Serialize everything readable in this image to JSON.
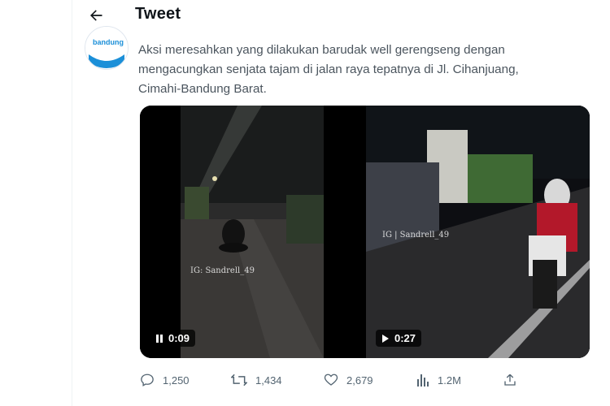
{
  "header": {
    "title": "Tweet"
  },
  "account": {
    "avatar_text": "bandung"
  },
  "tweet": {
    "text": "Aksi meresahkan yang dilakukan barudak well gerengseng dengan\nmengacungkan senjata tajam di jalan raya tepatnya di Jl. Cihanjuang,\nCimahi-Bandung Barat."
  },
  "media": [
    {
      "duration": "0:09",
      "state_icon": "pause-icon",
      "watermark": "IG: Sandrell_49"
    },
    {
      "duration": "0:27",
      "state_icon": "play-icon",
      "watermark": "IG | Sandrell_49"
    }
  ],
  "actions": {
    "replies": "1,250",
    "retweets": "1,434",
    "likes": "2,679",
    "views": "1.2M"
  },
  "colors": {
    "accent": "#1d9bf0",
    "muted": "#536471",
    "text": "#0f1419"
  }
}
